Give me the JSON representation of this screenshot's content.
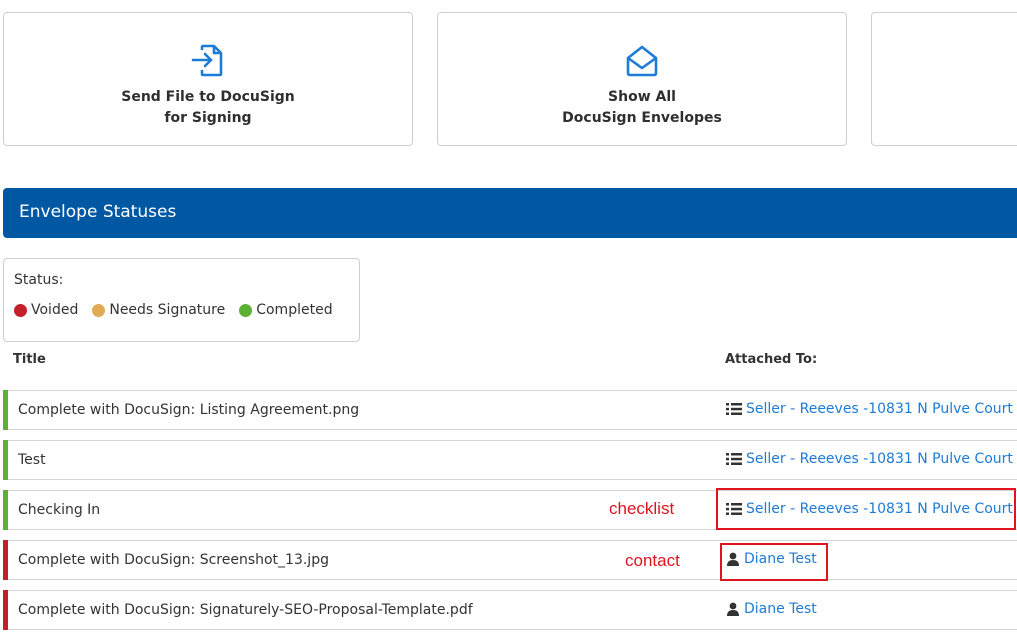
{
  "cards": {
    "send": {
      "line1": "Send File to DocuSign",
      "line2": "for Signing",
      "icon": "file-import-icon"
    },
    "show": {
      "line1": "Show All",
      "line2": "DocuSign Envelopes",
      "icon": "envelope-open-icon"
    }
  },
  "section": {
    "title": "Envelope Statuses"
  },
  "legend": {
    "heading": "Status:",
    "items": [
      {
        "label": "Voided",
        "color": "#c3202c"
      },
      {
        "label": "Needs Signature",
        "color": "#e0ab52"
      },
      {
        "label": "Completed",
        "color": "#5cb135"
      }
    ]
  },
  "table": {
    "columns": {
      "title": "Title",
      "attached": "Attached To:"
    },
    "rows": [
      {
        "title": "Complete with DocuSign: Listing Agreement.png",
        "attached": "Seller - Reeeves -10831 N Pulve Court",
        "attached_type": "checklist",
        "status_color": "#5cb135"
      },
      {
        "title": "Test",
        "attached": "Seller - Reeeves -10831 N Pulve Court",
        "attached_type": "checklist",
        "status_color": "#5cb135"
      },
      {
        "title": "Checking In",
        "attached": "Seller - Reeeves -10831 N Pulve Court",
        "attached_type": "checklist",
        "status_color": "#5cb135"
      },
      {
        "title": "Complete with DocuSign: Screenshot_13.jpg",
        "attached": "Diane Test",
        "attached_type": "contact",
        "status_color": "#c3202c"
      },
      {
        "title": "Complete with DocuSign: Signaturely-SEO-Proposal-Template.pdf",
        "attached": "Diane Test",
        "attached_type": "contact",
        "status_color": "#c3202c"
      }
    ]
  },
  "annotations": {
    "checklist": "checklist",
    "contact": "contact"
  }
}
